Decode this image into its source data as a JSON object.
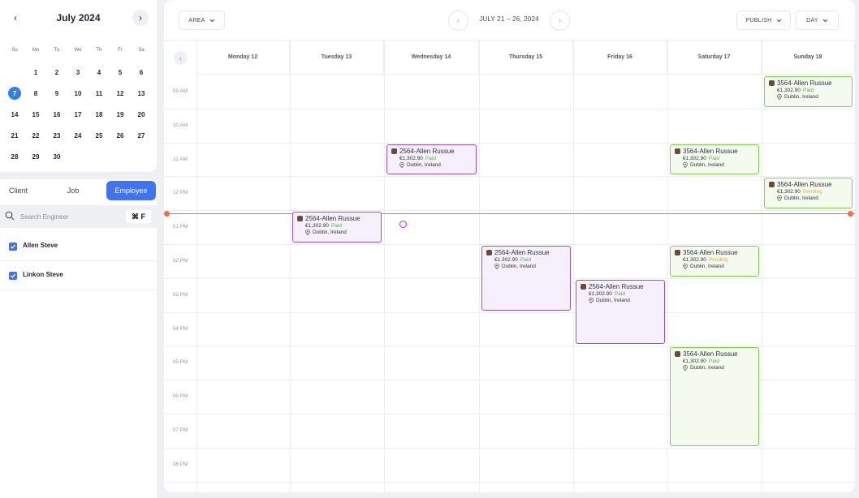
{
  "mini_calendar": {
    "month_title": "July 2024",
    "weekdays": [
      "Su",
      "Mo",
      "Tu",
      "We",
      "Th",
      "Fr",
      "Sa"
    ],
    "weeks": [
      [
        "",
        "1",
        "2",
        "3",
        "4",
        "5",
        "6"
      ],
      [
        "7",
        "8",
        "9",
        "10",
        "11",
        "12",
        "13"
      ],
      [
        "14",
        "15",
        "16",
        "17",
        "18",
        "19",
        "20"
      ],
      [
        "21",
        "22",
        "23",
        "24",
        "25",
        "26",
        "27"
      ],
      [
        "28",
        "29",
        "30",
        "",
        "",
        "",
        ""
      ]
    ],
    "selected_day": "7",
    "accent_color": "#2f80ed"
  },
  "sidebar": {
    "tabs": {
      "client": "Client",
      "job": "Job",
      "employee": "Employee"
    },
    "active_tab": "Employee",
    "search": {
      "placeholder": "Search Engineer",
      "shortcut": "⌘ F"
    },
    "engineers": [
      {
        "name": "Allen Steve",
        "checked": true
      },
      {
        "name": "Linkon Steve",
        "checked": true
      }
    ]
  },
  "toolbar": {
    "area_label": "AREA",
    "date_range": "JULY 21 – 26, 2024",
    "publish_label": "PUBLISH",
    "view_label": "DAY"
  },
  "calendar": {
    "days": [
      "Monday 12",
      "Tuesday 13",
      "Wednesday 14",
      "Thursday 15",
      "Friday 16",
      "Saturday 17",
      "Sunday 18"
    ],
    "hours": [
      "09 AM",
      "10 AM",
      "11 AM",
      "12 PM",
      "01 PM",
      "02 PM",
      "03 PM",
      "04 PM",
      "05 PM",
      "06 PM",
      "07 PM",
      "08 PM"
    ],
    "current_time_color": "#f06c4f",
    "events": [
      {
        "title": "3564-Allen Russue",
        "amount": "€1,302.90",
        "status": "Paid",
        "location": "Dublin, Ireland",
        "style": "green"
      },
      {
        "title": "2564-Allen Russue",
        "amount": "€1,302.90",
        "status": "Paid",
        "location": "Dublin, Ireland",
        "style": "purple"
      },
      {
        "title": "3564-Allen Russue",
        "amount": "€1,302.90",
        "status": "Paid",
        "location": "Dublin, Ireland",
        "style": "green"
      },
      {
        "title": "3564-Allen Russue",
        "amount": "€1,302.90",
        "status": "Pending",
        "location": "Dublin, Ireland",
        "style": "green"
      },
      {
        "title": "2564-Allen Russue",
        "amount": "€1,302.90",
        "status": "Paid",
        "location": "Dublin, Ireland",
        "style": "purple"
      },
      {
        "title": "2564-Allen Russue",
        "amount": "€1,302.90",
        "status": "Paid",
        "location": "Dublin, Ireland",
        "style": "purple"
      },
      {
        "title": "3564-Allen Russue",
        "amount": "€1,302.90",
        "status": "Pending",
        "location": "Dublin, Ireland",
        "style": "green"
      },
      {
        "title": "2564-Allen Russue",
        "amount": "€1,302.90",
        "status": "Paid",
        "location": "Dublin, Ireland",
        "style": "purple"
      },
      {
        "title": "3564-Allen Russue",
        "amount": "€1,302.90",
        "status": "Paid",
        "location": "Dublin, Ireland",
        "style": "green"
      }
    ],
    "status_colors": {
      "Paid": "#52b83a",
      "Pending": "#f5a623"
    }
  }
}
